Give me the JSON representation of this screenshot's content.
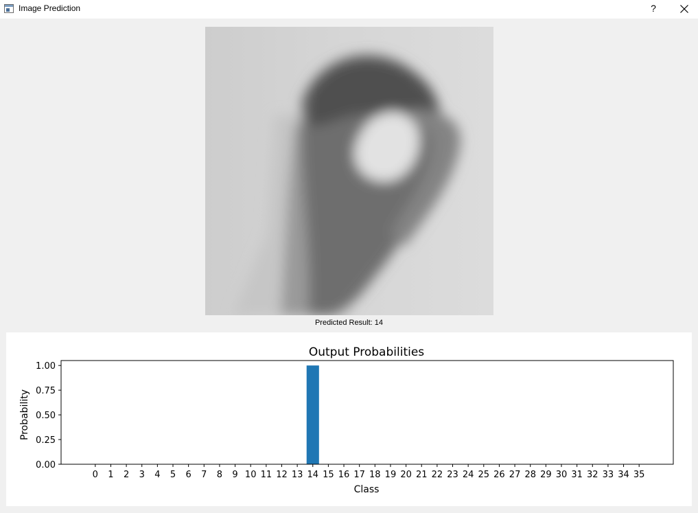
{
  "window": {
    "title": "Image Prediction",
    "help_label": "?"
  },
  "prediction": {
    "result_text": "Predicted Result: 14"
  },
  "chart_data": {
    "type": "bar",
    "title": "Output Probabilities",
    "xlabel": "Class",
    "ylabel": "Probability",
    "categories": [
      "0",
      "1",
      "2",
      "3",
      "4",
      "5",
      "6",
      "7",
      "8",
      "9",
      "10",
      "11",
      "12",
      "13",
      "14",
      "15",
      "16",
      "17",
      "18",
      "19",
      "20",
      "21",
      "22",
      "23",
      "24",
      "25",
      "26",
      "27",
      "28",
      "29",
      "30",
      "31",
      "32",
      "33",
      "34",
      "35"
    ],
    "values": [
      0,
      0,
      0,
      0,
      0,
      0,
      0,
      0,
      0,
      0,
      0,
      0,
      0,
      0,
      1.0,
      0,
      0,
      0,
      0,
      0,
      0,
      0,
      0,
      0,
      0,
      0,
      0,
      0,
      0,
      0,
      0,
      0,
      0,
      0,
      0,
      0
    ],
    "yticks": [
      "0.00",
      "0.25",
      "0.50",
      "0.75",
      "1.00"
    ],
    "ylim": [
      0,
      1.05
    ],
    "grid": false,
    "bar_color": "#1f77b4"
  },
  "colors": {
    "background": "#f0f0f0",
    "titlebar": "#ffffff",
    "chart_background": "#ffffff"
  }
}
